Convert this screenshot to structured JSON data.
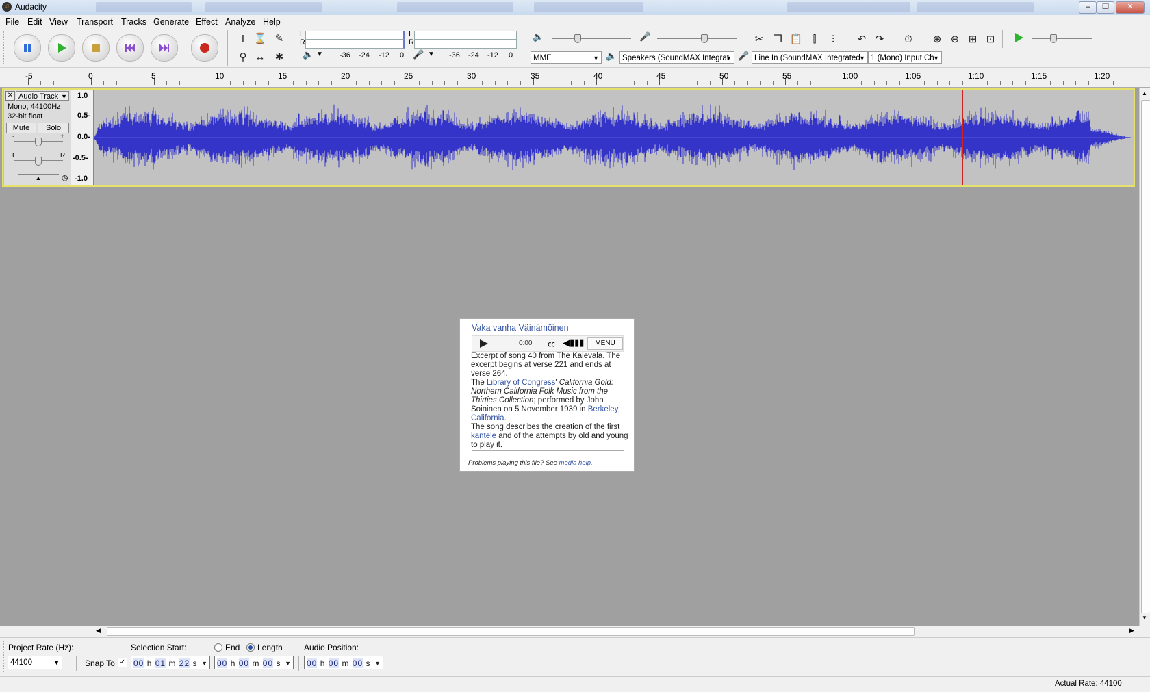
{
  "window": {
    "title": "Audacity"
  },
  "menubar": {
    "items": [
      "File",
      "Edit",
      "View",
      "Transport",
      "Tracks",
      "Generate",
      "Effect",
      "Analyze",
      "Help"
    ]
  },
  "meters": {
    "playback_scale": [
      "-36",
      "-24",
      "-12",
      "0"
    ],
    "record_scale": [
      "-36",
      "-24",
      "-12",
      "0"
    ],
    "ch_left": "L",
    "ch_right": "R"
  },
  "device": {
    "host": "MME",
    "output": "Speakers (SoundMAX Integrat",
    "input": "Line In (SoundMAX Integrated",
    "channels": "1 (Mono) Input Ch"
  },
  "ruler": {
    "labels": [
      "-5",
      "0",
      "5",
      "10",
      "15",
      "20",
      "25",
      "30",
      "35",
      "40",
      "45",
      "50",
      "55",
      "1:00",
      "1:05",
      "1:10",
      "1:15",
      "1:20"
    ]
  },
  "track": {
    "name": "Audio Track",
    "info1": "Mono, 44100Hz",
    "info2": "32-bit float",
    "mute": "Mute",
    "solo": "Solo",
    "scale": [
      "1.0",
      "0.5-",
      "0.0-",
      "-0.5-",
      "-1.0"
    ],
    "gain_minus": "-",
    "gain_plus": "+",
    "pan_l": "L",
    "pan_r": "R"
  },
  "popup": {
    "title": "Vaka vanha Väinämöinen",
    "time": "0:00",
    "menu": "MENU",
    "p1": "Excerpt of song 40 from The Kalevala. The excerpt begins at verse 221 and ends at verse 264.",
    "p2_a": "The ",
    "p2_link": "Library of Congress",
    "p2_b": "' ",
    "p2_italic": "California Gold: Northern California Folk Music from the Thirties Collection",
    "p2_c": "; performed by John Soininen on 5 November 1939 in ",
    "p2_link2": "Berkeley, California",
    "p2_d": ".",
    "p3_a": "The song describes the creation of the first ",
    "p3_link": "kantele",
    "p3_b": " and of the attempts by old and young to play it.",
    "footer_a": "Problems playing this file? See ",
    "footer_link": "media help",
    "footer_b": "."
  },
  "selection": {
    "rate_label": "Project Rate (Hz):",
    "rate_value": "44100",
    "snap_label": "Snap To",
    "start_label": "Selection Start:",
    "end_label": "End",
    "length_label": "Length",
    "position_label": "Audio Position:",
    "start": {
      "h": "00",
      "m": "01",
      "s": "22"
    },
    "length": {
      "h": "00",
      "m": "00",
      "s": "00"
    },
    "position": {
      "h": "00",
      "m": "00",
      "s": "00"
    },
    "unit_h": "h",
    "unit_m": "m",
    "unit_s": "s"
  },
  "status": {
    "actual_rate": "Actual Rate: 44100"
  },
  "colors": {
    "waveform": "#3434c9",
    "cursor": "#d02020",
    "track_border": "#e5e16a",
    "background": "#a0a0a0"
  }
}
